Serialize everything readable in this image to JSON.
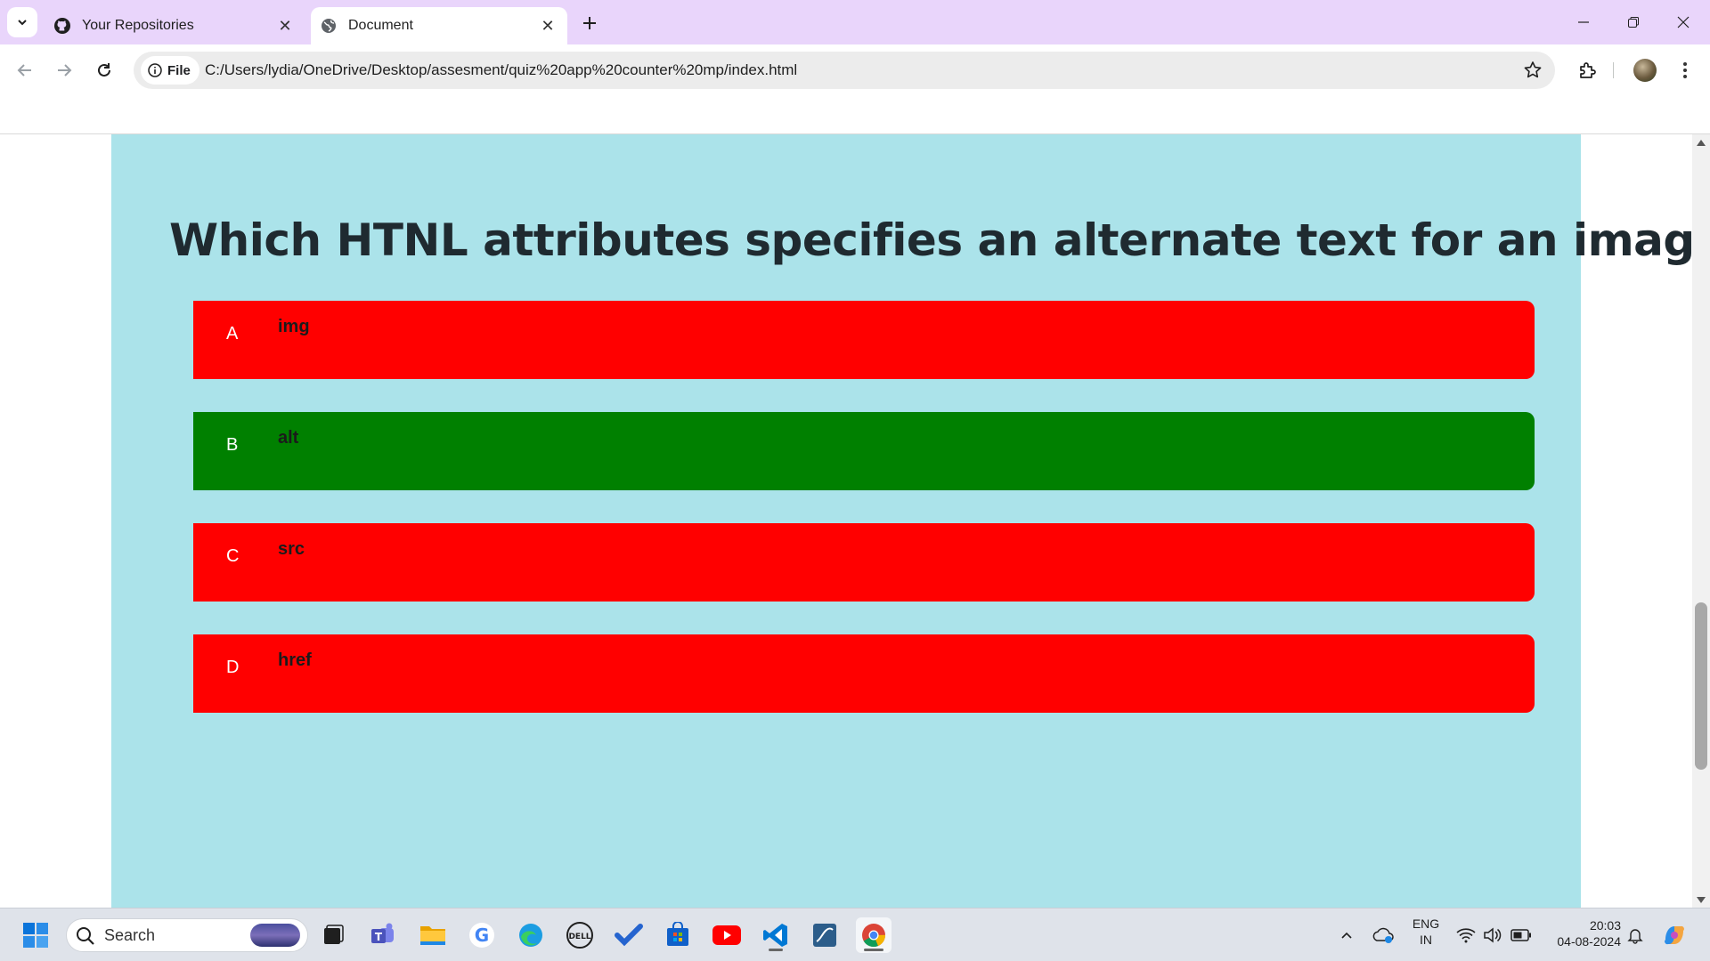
{
  "browser": {
    "tabs": [
      {
        "title": "Your Repositories",
        "favicon": "github-icon",
        "active": false
      },
      {
        "title": "Document",
        "favicon": "globe-icon",
        "active": true
      }
    ],
    "address_chip": "File",
    "url": "C:/Users/lydia/OneDrive/Desktop/assesment/quiz%20app%20counter%20mp/index.html"
  },
  "quiz": {
    "question": "Which HTNL attributes specifies an alternate text for an image?",
    "options": [
      {
        "letter": "A",
        "text": "img",
        "color": "#ff0000"
      },
      {
        "letter": "B",
        "text": "alt",
        "color": "#008000"
      },
      {
        "letter": "C",
        "text": "src",
        "color": "#ff0000"
      },
      {
        "letter": "D",
        "text": "href",
        "color": "#ff0000"
      }
    ],
    "card_color": "#abe3ea"
  },
  "taskbar": {
    "search_placeholder": "Search",
    "apps": [
      "windows-start-icon",
      "task-view-icon",
      "teams-icon",
      "file-explorer-icon",
      "google-icon",
      "edge-icon",
      "dell-icon",
      "todo-icon",
      "store-icon",
      "youtube-icon",
      "vscode-icon",
      "mysql-workbench-icon",
      "chrome-icon"
    ],
    "language": "ENG",
    "region": "IN",
    "time": "20:03",
    "date": "04-08-2024"
  }
}
